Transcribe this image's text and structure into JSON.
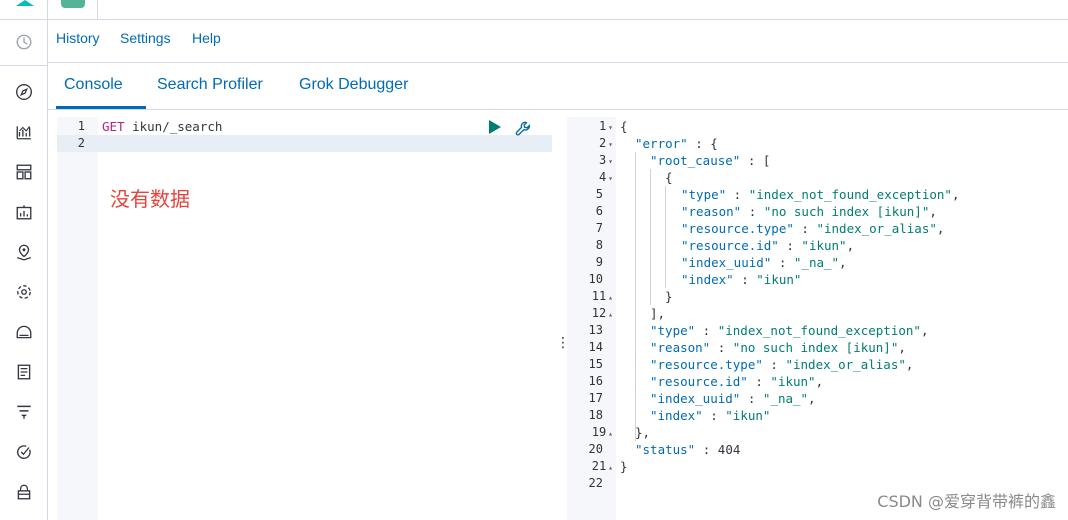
{
  "menu": {
    "history": "History",
    "settings": "Settings",
    "help": "Help"
  },
  "tabs": {
    "console": "Console",
    "search_profiler": "Search Profiler",
    "grok_debugger": "Grok Debugger"
  },
  "request": {
    "lines": [
      {
        "num": "1",
        "method": "GET",
        "path": " ikun/_search"
      },
      {
        "num": "2"
      }
    ]
  },
  "annotation": "没有数据",
  "response": {
    "lines": [
      {
        "num": "1",
        "fold": "▾"
      },
      {
        "num": "2",
        "fold": "▾"
      },
      {
        "num": "3",
        "fold": "▾"
      },
      {
        "num": "4",
        "fold": "▾"
      },
      {
        "num": "5"
      },
      {
        "num": "6"
      },
      {
        "num": "7"
      },
      {
        "num": "8"
      },
      {
        "num": "9"
      },
      {
        "num": "10"
      },
      {
        "num": "11",
        "fold": "▴"
      },
      {
        "num": "12",
        "fold": "▴"
      },
      {
        "num": "13"
      },
      {
        "num": "14"
      },
      {
        "num": "15"
      },
      {
        "num": "16"
      },
      {
        "num": "17"
      },
      {
        "num": "18"
      },
      {
        "num": "19",
        "fold": "▴"
      },
      {
        "num": "20"
      },
      {
        "num": "21",
        "fold": "▴"
      },
      {
        "num": "22"
      }
    ],
    "text": {
      "l1": "{",
      "l2_key": "\"error\"",
      "l2_rest": " : {",
      "l3_key": "\"root_cause\"",
      "l3_rest": " : [",
      "l4": "{",
      "l5_key": "\"type\"",
      "l5_val": "\"index_not_found_exception\"",
      "l6_key": "\"reason\"",
      "l6_val": "\"no such index [ikun]\"",
      "l7_key": "\"resource.type\"",
      "l7_val": "\"index_or_alias\"",
      "l8_key": "\"resource.id\"",
      "l8_val": "\"ikun\"",
      "l9_key": "\"index_uuid\"",
      "l9_val": "\"_na_\"",
      "l10_key": "\"index\"",
      "l10_val": "\"ikun\"",
      "l11": "}",
      "l12": "],",
      "l13_key": "\"type\"",
      "l13_val": "\"index_not_found_exception\"",
      "l14_key": "\"reason\"",
      "l14_val": "\"no such index [ikun]\"",
      "l15_key": "\"resource.type\"",
      "l15_val": "\"index_or_alias\"",
      "l16_key": "\"resource.id\"",
      "l16_val": "\"ikun\"",
      "l17_key": "\"index_uuid\"",
      "l17_val": "\"_na_\"",
      "l18_key": "\"index\"",
      "l18_val": "\"ikun\"",
      "l19": "},",
      "l20_key": "\"status\"",
      "l20_val": "404",
      "l21": "}"
    }
  },
  "watermark": "CSDN @爱穿背带裤的鑫",
  "colors": {
    "accent": "#006bb4",
    "run": "#017d73",
    "annotation": "#e7433b"
  }
}
